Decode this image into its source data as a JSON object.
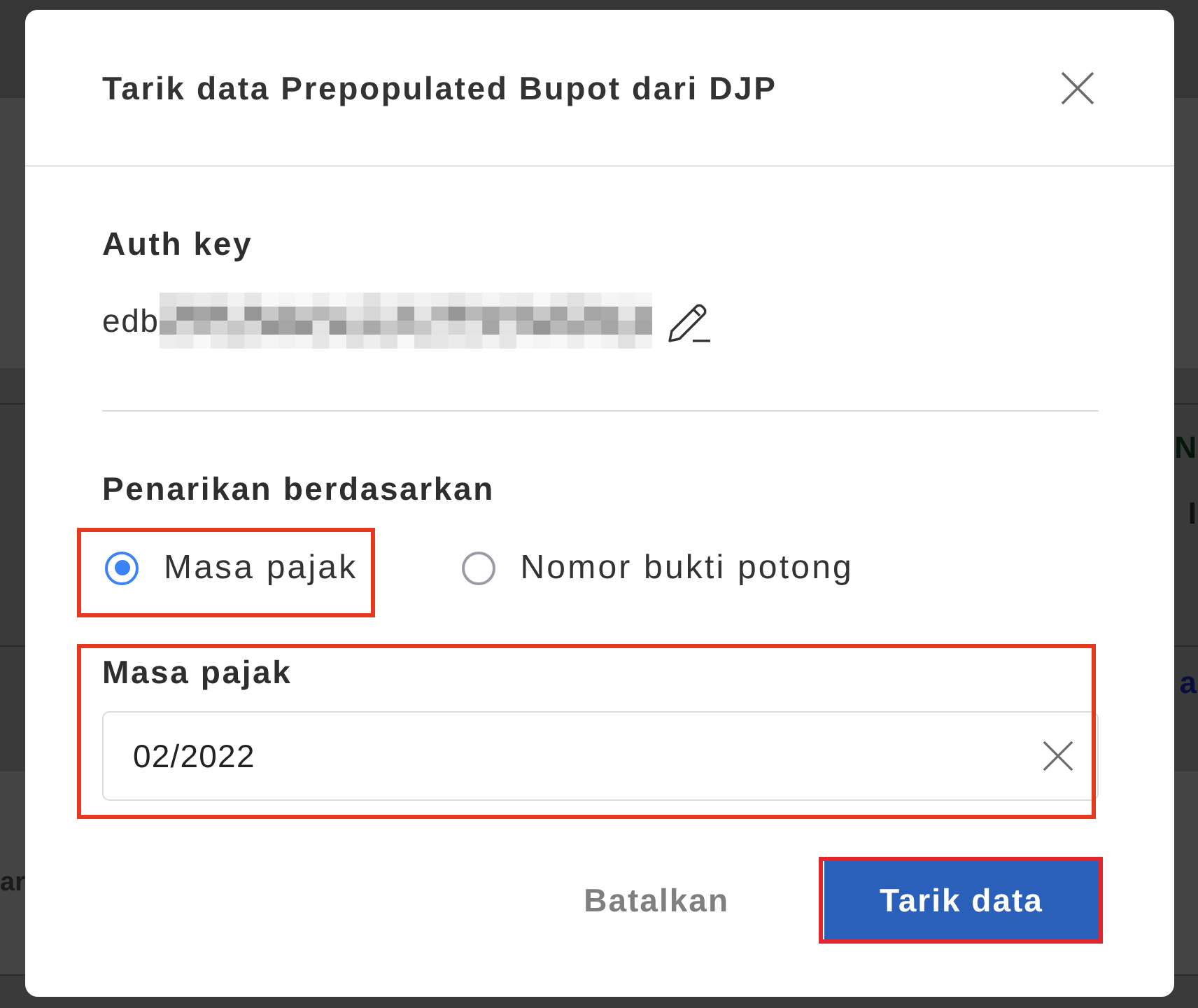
{
  "background_page": {
    "left_texts": [
      {
        "text": "ar",
        "color": "#1a1a1a"
      }
    ],
    "right_texts": [
      {
        "text": "N",
        "color": "#07160c"
      },
      {
        "text": "I",
        "color": "#111111"
      },
      {
        "text": "a",
        "color": "#0a0e3c"
      }
    ]
  },
  "dialog": {
    "title": "Tarik data Prepopulated Bupot dari DJP"
  },
  "auth_key": {
    "label": "Auth key",
    "value": "edb"
  },
  "pull_by": {
    "label": "Penarikan berdasarkan",
    "options": [
      {
        "label": "Masa pajak",
        "selected": true,
        "highlighted": true
      },
      {
        "label": "Nomor bukti potong",
        "selected": false,
        "highlighted": false
      }
    ]
  },
  "tax_period": {
    "label": "Masa pajak",
    "value": "02/2022",
    "highlighted": true
  },
  "buttons": [
    {
      "label": "Batalkan",
      "kind": "text",
      "highlighted": false
    },
    {
      "label": "Tarik data",
      "kind": "primary",
      "highlighted": true
    }
  ]
}
